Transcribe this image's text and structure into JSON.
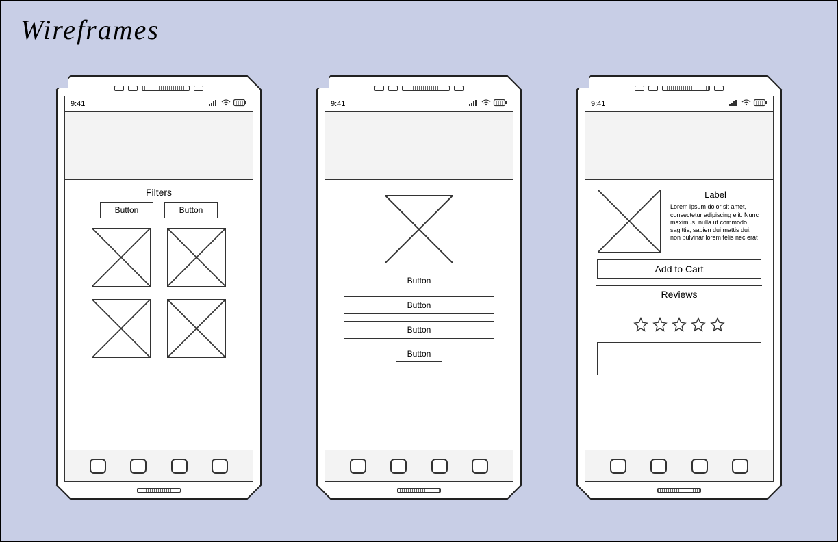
{
  "page_title": "Wireframes",
  "status_time": "9:41",
  "screen1": {
    "filters_title": "Filters",
    "filter_btn_a": "Button",
    "filter_btn_b": "Button"
  },
  "screen2": {
    "btn1": "Button",
    "btn2": "Button",
    "btn3": "Button",
    "btn4": "Button"
  },
  "screen3": {
    "label": "Label",
    "lorem": "Lorem ipsum dolor sit amet, consectetur adipiscing elit. Nunc maximus, nulla ut commodo sagittis, sapien dui mattis dui, non pulvinar lorem felis nec erat",
    "add_to_cart": "Add to Cart",
    "reviews_title": "Reviews"
  }
}
